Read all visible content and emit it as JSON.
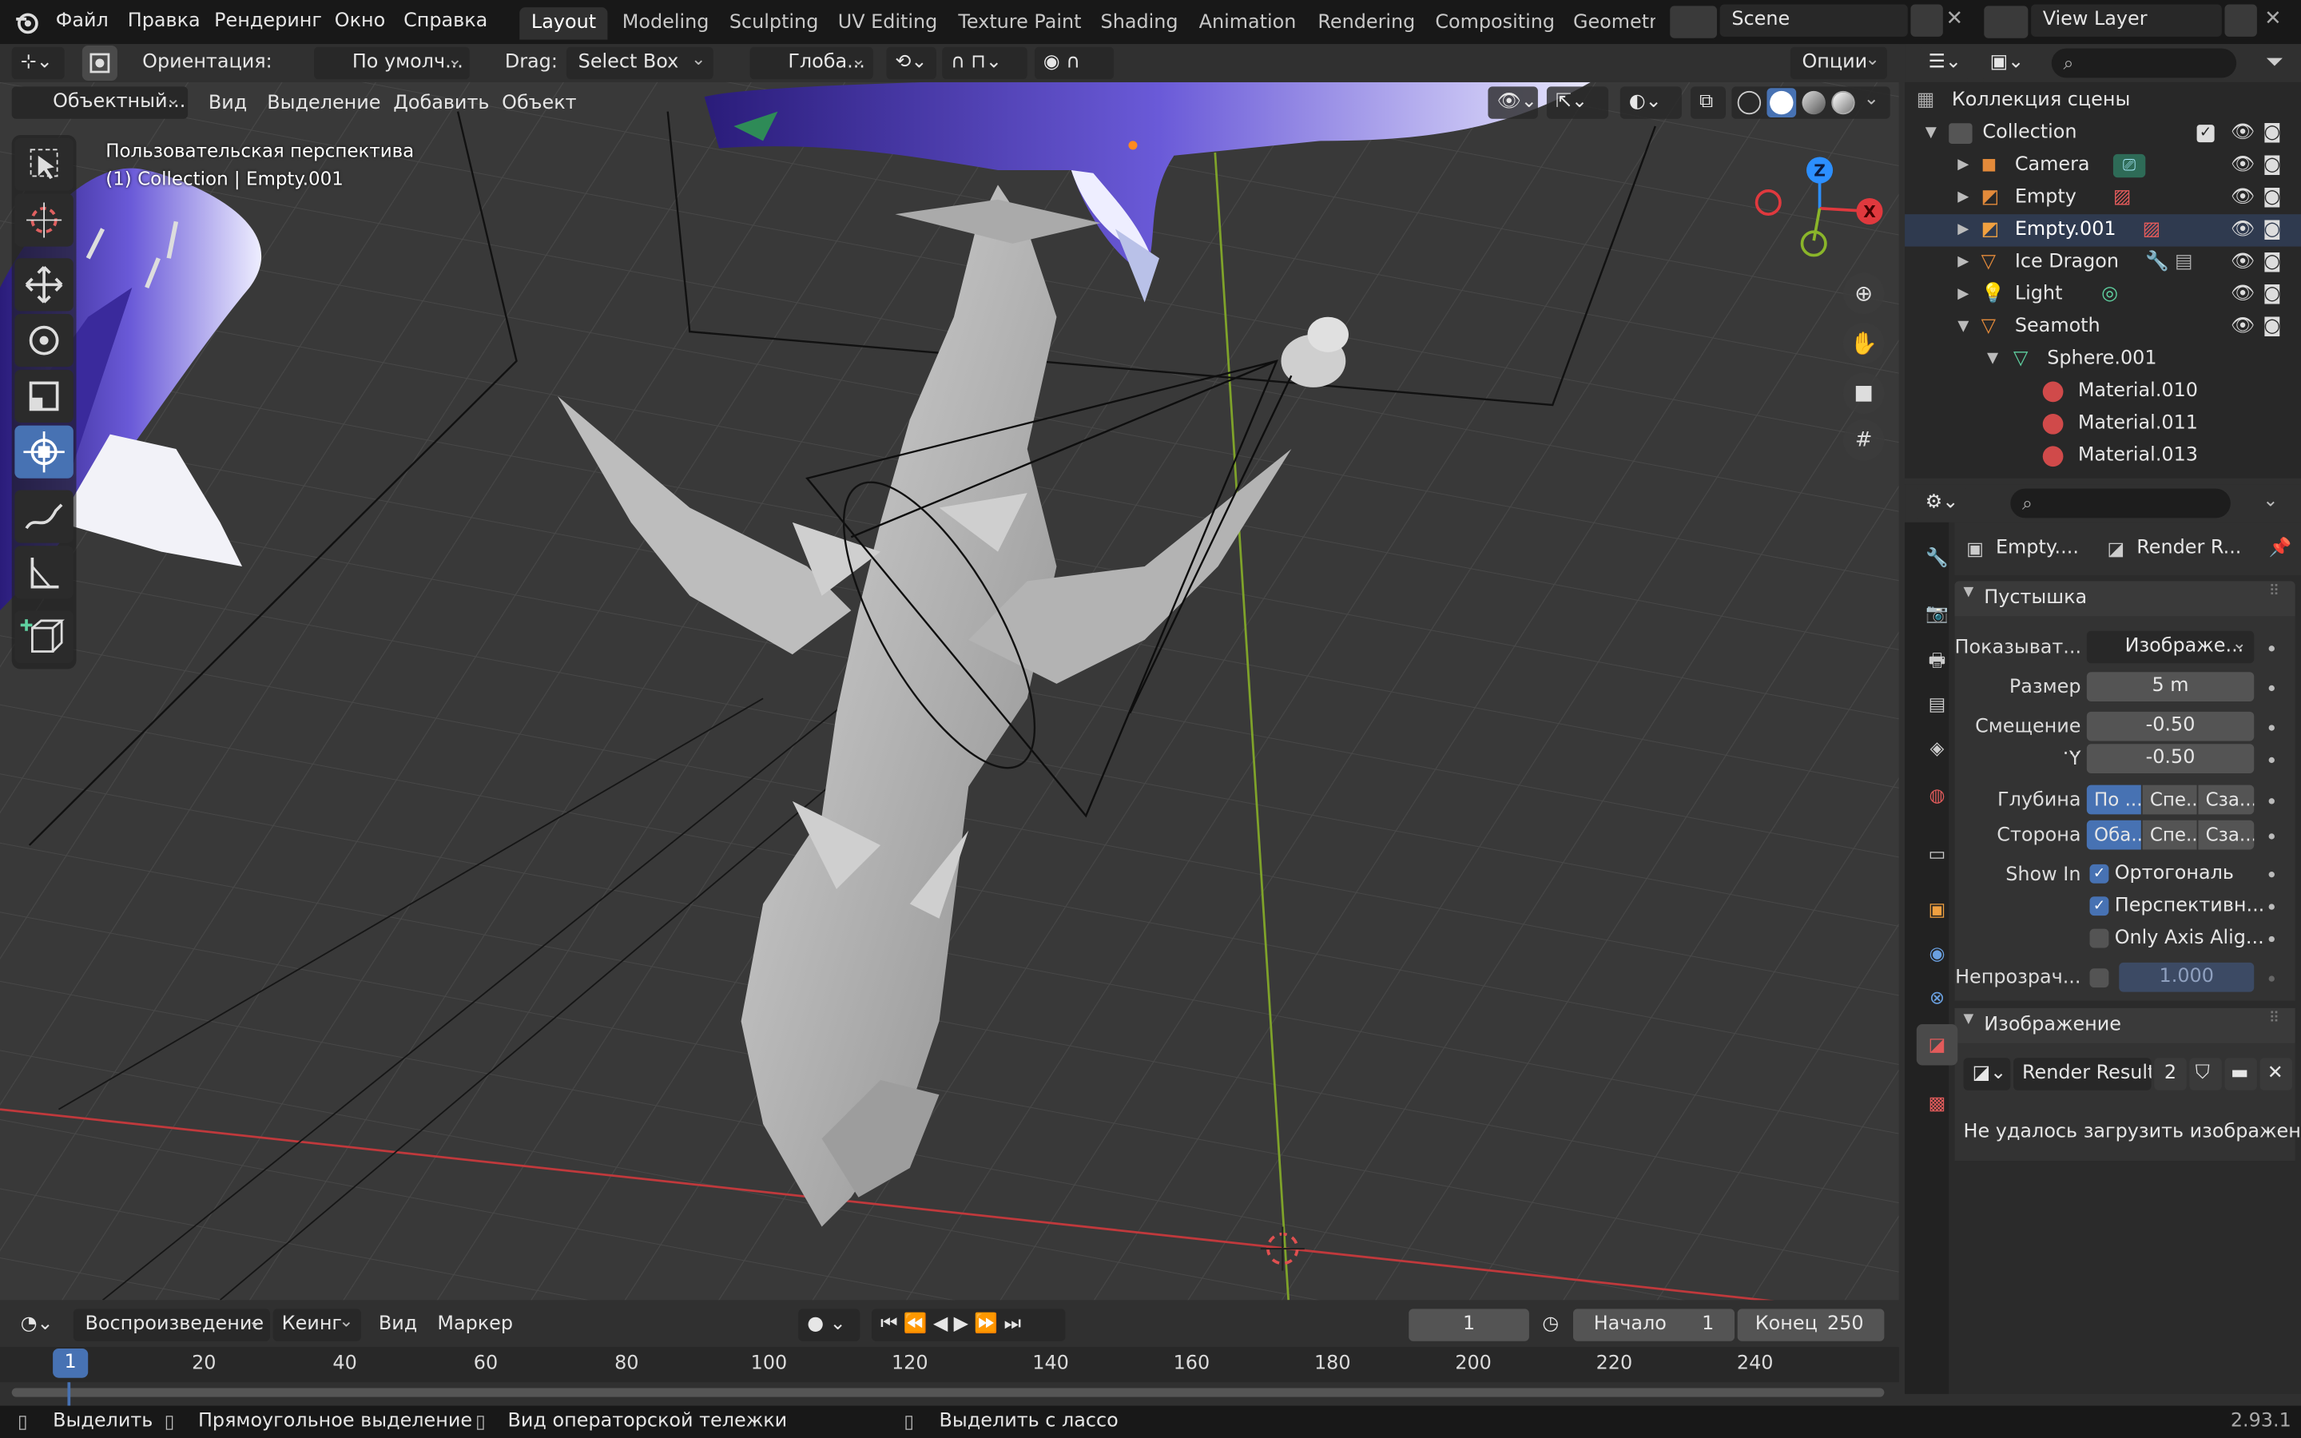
{
  "topbar": {
    "menu": [
      "Файл",
      "Правка",
      "Рендеринг",
      "Окно",
      "Справка"
    ],
    "workspaces": [
      "Layout",
      "Modeling",
      "Sculpting",
      "UV Editing",
      "Texture Paint",
      "Shading",
      "Animation",
      "Rendering",
      "Compositing",
      "Geometry"
    ],
    "active_workspace": "Layout",
    "scene": "Scene",
    "view_layer": "View Layer"
  },
  "viewport_header": {
    "orientation_label": "Ориентация:",
    "orientation_value": "По умолч...",
    "drag_label": "Drag:",
    "drag_value": "Select Box",
    "transform_orientation": "Глоба...",
    "options": "Опции",
    "mode": "Объектный...",
    "menus": [
      "Вид",
      "Выделение",
      "Добавить",
      "Объект"
    ]
  },
  "viewport": {
    "view_name": "Пользовательская перспектива",
    "collection_info": "(1) Collection | Empty.001",
    "gizmo_axes": [
      "Z",
      "X"
    ]
  },
  "outliner": {
    "title": "Коллекция сцены",
    "rows": [
      {
        "label": "Collection",
        "icon": "collection-icon"
      },
      {
        "label": "Camera",
        "icon": "camera-icon"
      },
      {
        "label": "Empty",
        "icon": "empty-icon"
      },
      {
        "label": "Empty.001",
        "icon": "empty-icon"
      },
      {
        "label": "Ice Dragon",
        "icon": "mesh-object-icon"
      },
      {
        "label": "Light",
        "icon": "light-icon"
      },
      {
        "label": "Seamoth",
        "icon": "mesh-object-icon"
      },
      {
        "label": "Sphere.001",
        "icon": "mesh-data-icon"
      },
      {
        "label": "Material.010",
        "icon": "material-icon"
      },
      {
        "label": "Material.011",
        "icon": "material-icon"
      },
      {
        "label": "Material.013",
        "icon": "material-icon"
      }
    ]
  },
  "properties": {
    "breadcrumb_object": "Empty....",
    "breadcrumb_data": "Render R...",
    "panel_title": "Пустышка",
    "display_label": "Показыват...",
    "display_value": "Изображе...",
    "size_label": "Размер",
    "size_value": "5 m",
    "offset_label": "Смещение ...",
    "offset_x": "-0.50",
    "offset_y_label": "Y",
    "offset_y": "-0.50",
    "depth_label": "Глубина",
    "depth_options": [
      "По ...",
      "Спе...",
      "Сза..."
    ],
    "side_label": "Сторона",
    "side_options": [
      "Оба...",
      "Спе...",
      "Сза..."
    ],
    "show_in_label": "Show In",
    "show_in_options": [
      "Ортогональ",
      "Перспективн...",
      "Only Axis Alig..."
    ],
    "opacity_label": "Непрозрач...",
    "opacity_value": "1.000",
    "image_panel_title": "Изображение",
    "image_name": "Render Result",
    "image_users": "2",
    "error_text": "Не удалось загрузить изображение"
  },
  "timeline": {
    "menus": [
      "Воспроизведение",
      "Кеинг",
      "Вид",
      "Маркер"
    ],
    "current_frame": "1",
    "start_label": "Начало",
    "start_value": "1",
    "end_label": "Конец",
    "end_value": "250",
    "ticks": [
      "1",
      "20",
      "40",
      "60",
      "80",
      "100",
      "120",
      "140",
      "160",
      "180",
      "200",
      "220",
      "240"
    ]
  },
  "statusbar": {
    "select": "Выделить",
    "box_select": "Прямоугольное выделение",
    "dolly": "Вид операторской тележки",
    "lasso": "Выделить с лассо",
    "version": "2.93.1"
  },
  "colors": {
    "accent": "#4772b3",
    "x_axis": "#e0393e",
    "y_axis": "#8ab52a",
    "z_axis": "#2c8fff",
    "header": "#303030",
    "panel": "#2b2b2b"
  }
}
